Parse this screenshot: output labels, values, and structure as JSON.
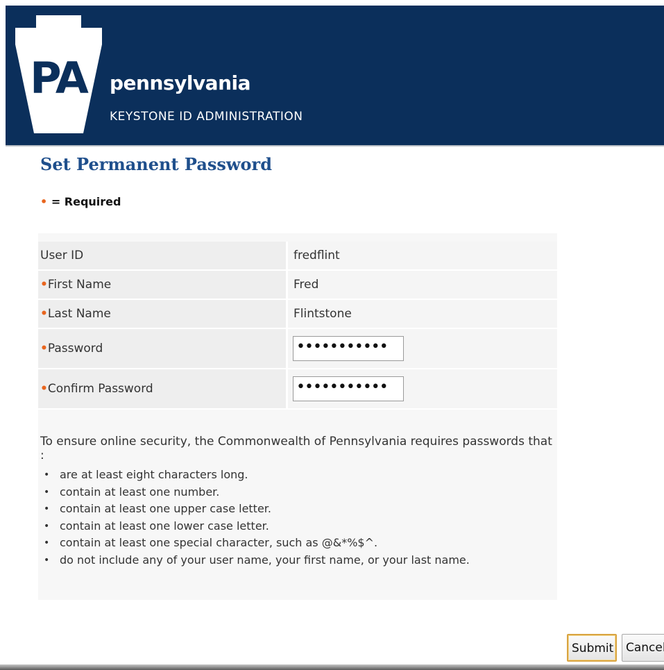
{
  "header": {
    "logo_text": "PA",
    "brand_name": "pennsylvania",
    "brand_subtitle": "KEYSTONE ID ADMINISTRATION",
    "background_color": "#0b2f5b"
  },
  "page": {
    "title": "Set Permanent Password",
    "required_marker": "•",
    "required_text": "= Required",
    "required_color": "#e8651e"
  },
  "form": {
    "user_id": {
      "label": "User ID",
      "value": "fredflint"
    },
    "first_name": {
      "marker": "•",
      "label": "First Name",
      "value": "Fred"
    },
    "last_name": {
      "marker": "•",
      "label": "Last Name",
      "value": "Flintstone"
    },
    "password": {
      "marker": "•",
      "label": "Password",
      "value": "•••••••••••"
    },
    "confirm_password": {
      "marker": "•",
      "label": "Confirm Password",
      "value": "•••••••••••"
    }
  },
  "rules": {
    "intro": "To ensure online security, the Commonwealth of Pennsylvania requires passwords that :",
    "items": [
      "are at least eight characters long.",
      "contain at least one number.",
      "contain at least one upper case letter.",
      "contain at least one lower case letter.",
      "contain at least one special character, such as @&*%$^.",
      "do not include any of your user name, your first name, or your last name."
    ]
  },
  "buttons": {
    "submit_label": "Submit",
    "cancel_label": "Cancel"
  }
}
